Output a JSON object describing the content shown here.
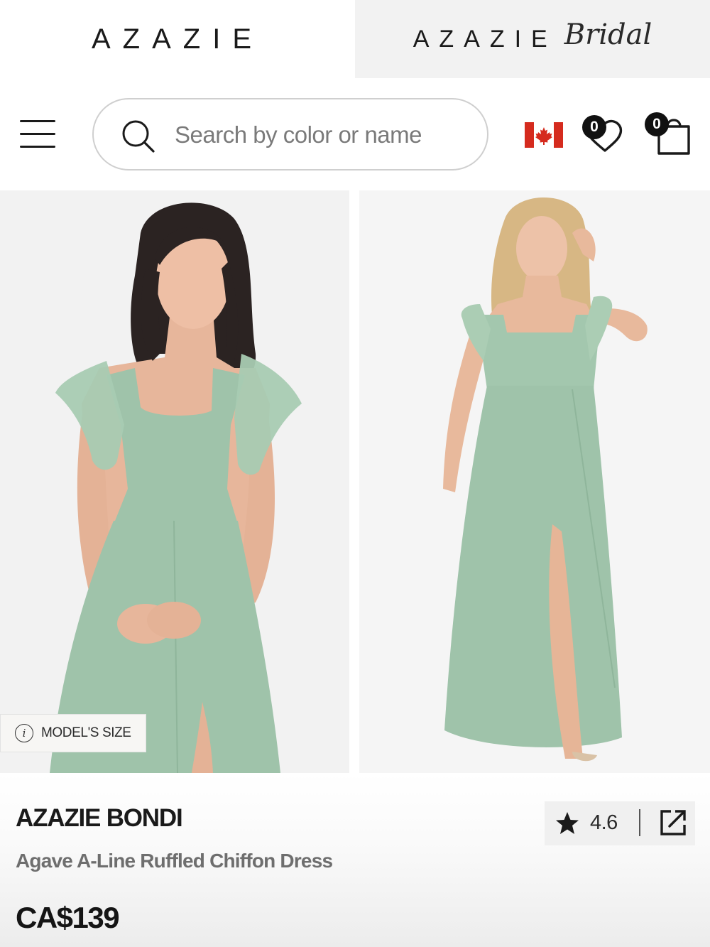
{
  "brand_tabs": {
    "main": {
      "label": "AZAZIE"
    },
    "bridal": {
      "label": "AZAZIE",
      "script": "Bridal"
    }
  },
  "header": {
    "search": {
      "placeholder": "Search by color or name",
      "icon": "search-icon"
    },
    "country": {
      "icon": "canada-flag-icon"
    },
    "wishlist": {
      "count": "0",
      "icon": "heart-icon"
    },
    "cart": {
      "count": "0",
      "icon": "shopping-bag-icon"
    },
    "menu_icon": "hamburger-menu-icon"
  },
  "gallery": {
    "dress_color": "#9fc3aa",
    "images": [
      {
        "alt": "model wearing dress, front close-up"
      },
      {
        "alt": "plus-size model wearing dress, full length"
      }
    ],
    "model_size_label": "MODEL'S SIZE"
  },
  "product": {
    "brand": "AZAZIE BONDI",
    "name": "Agave A-Line Ruffled Chiffon Dress",
    "price": "CA$139",
    "rating": "4.6"
  },
  "colors": {
    "flag_red": "#d52b1e",
    "text_dark": "#1a1a1a",
    "text_muted": "#6e6e6e"
  }
}
